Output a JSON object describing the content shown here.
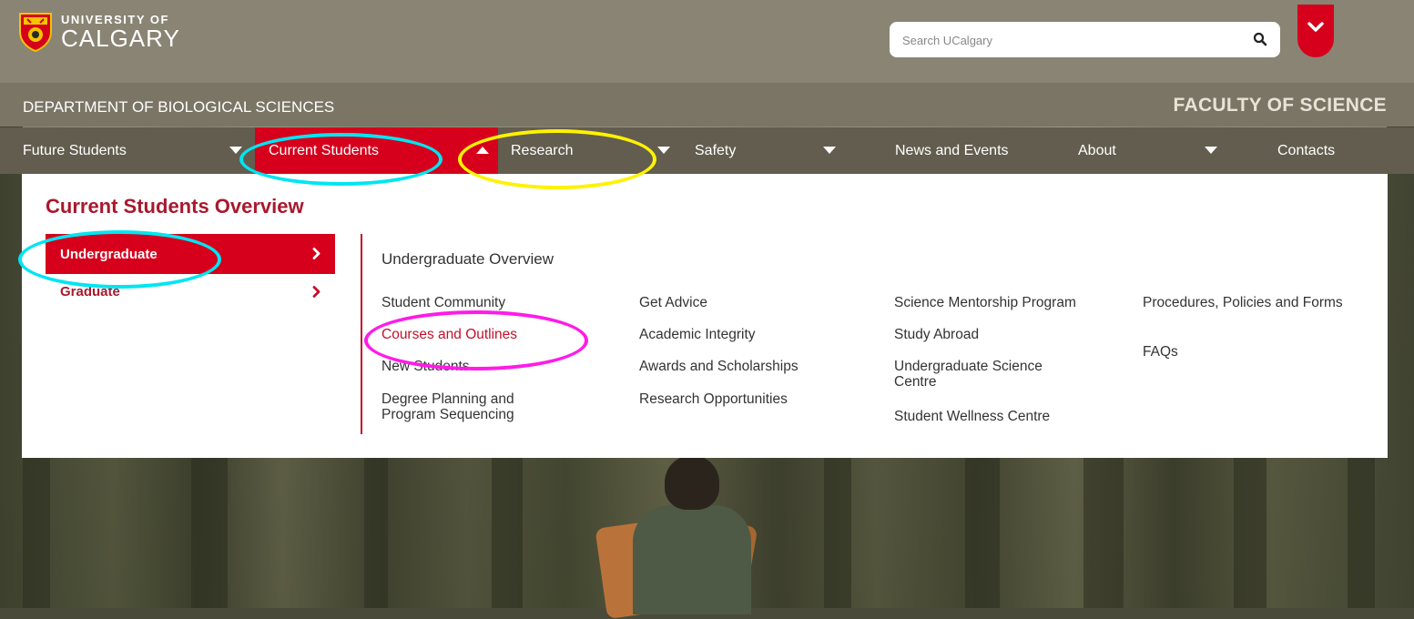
{
  "brand": {
    "line1": "UNIVERSITY OF",
    "line2": "CALGARY"
  },
  "search": {
    "placeholder": "Search UCalgary",
    "icon": "search-icon"
  },
  "dept": {
    "name": "DEPARTMENT OF BIOLOGICAL SCIENCES",
    "faculty": "FACULTY OF SCIENCE"
  },
  "nav": {
    "items": [
      {
        "label": "Future Students"
      },
      {
        "label": "Current Students"
      },
      {
        "label": "Research"
      },
      {
        "label": "Safety"
      },
      {
        "label": "News and Events"
      },
      {
        "label": "About"
      },
      {
        "label": "Contacts"
      }
    ]
  },
  "menu": {
    "title": "Current Students Overview",
    "side": [
      {
        "label": "Undergraduate"
      },
      {
        "label": "Graduate"
      }
    ],
    "section_title": "Undergraduate Overview",
    "columns": [
      [
        "Student Community",
        "Courses and Outlines",
        "New Students",
        "Degree Planning and Program Sequencing"
      ],
      [
        "Get Advice",
        "Academic Integrity",
        "Awards and Scholarships",
        "Research Opportunities"
      ],
      [
        "Science Mentorship Program",
        "Study Abroad",
        "Undergraduate Science Centre",
        "Student Wellness Centre"
      ],
      [
        "Procedures, Policies and Forms",
        "FAQs"
      ]
    ]
  },
  "colors": {
    "brand_red": "#d6001c",
    "link_red": "#c1102a",
    "annot_cyan": "#00e5f2",
    "annot_yellow": "#fff200",
    "annot_magenta": "#ff1be8"
  }
}
